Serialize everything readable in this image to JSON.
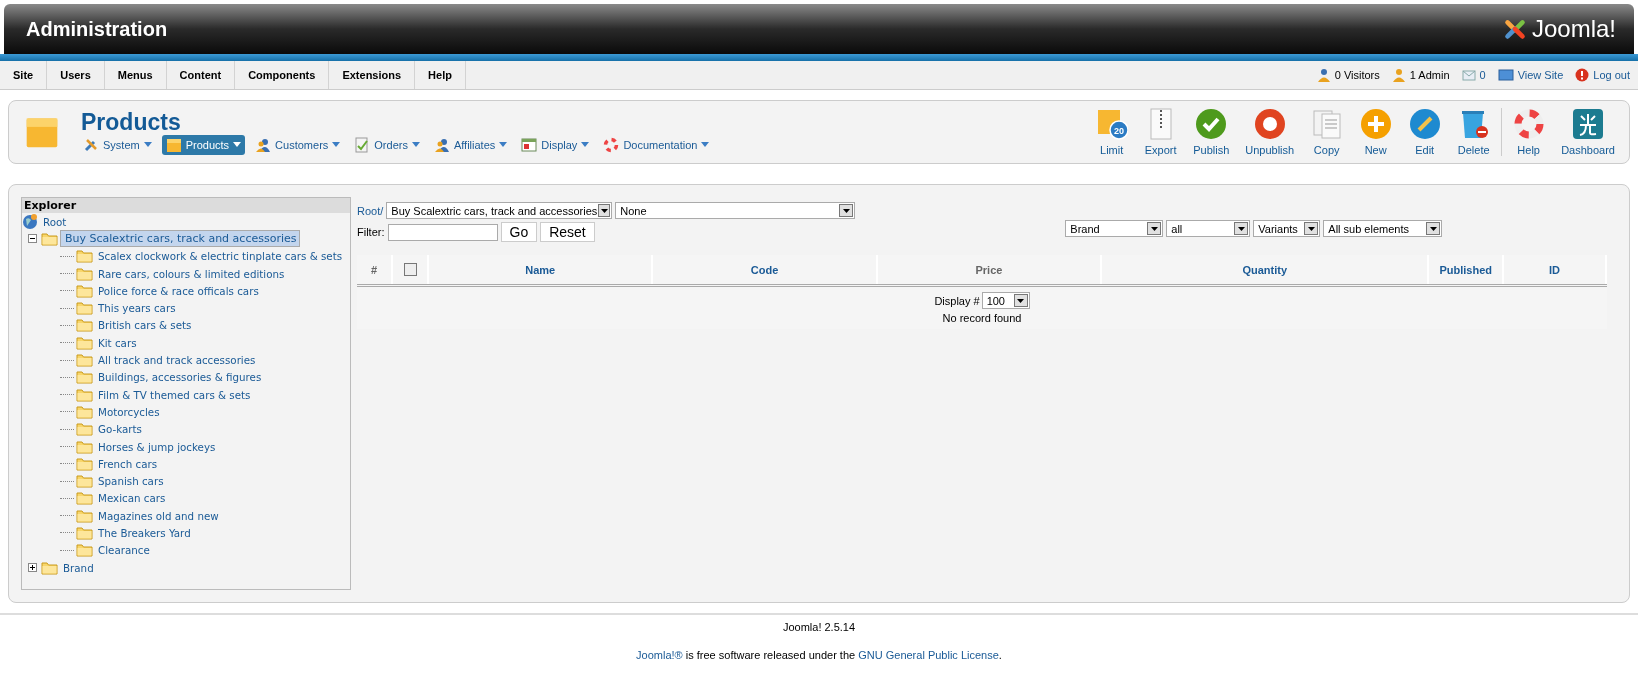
{
  "header": {
    "title": "Administration",
    "logo": "Joomla!"
  },
  "menu": {
    "items": [
      {
        "label": "Site"
      },
      {
        "label": "Users"
      },
      {
        "label": "Menus"
      },
      {
        "label": "Content"
      },
      {
        "label": "Components"
      },
      {
        "label": "Extensions"
      },
      {
        "label": "Help"
      }
    ],
    "status": [
      {
        "kind": "visitors",
        "label": "0 Visitors"
      },
      {
        "kind": "admin",
        "label": "1 Admin"
      },
      {
        "kind": "messages",
        "label": "0"
      },
      {
        "kind": "viewsite",
        "label": "View Site"
      },
      {
        "kind": "logout",
        "label": "Log out"
      }
    ]
  },
  "toolbar": {
    "title": "Products",
    "submenu": [
      {
        "kind": "system",
        "label": "System",
        "selected": false
      },
      {
        "kind": "products",
        "label": "Products",
        "selected": true
      },
      {
        "kind": "customers",
        "label": "Customers",
        "selected": false
      },
      {
        "kind": "orders",
        "label": "Orders",
        "selected": false
      },
      {
        "kind": "affiliates",
        "label": "Affiliates",
        "selected": false
      },
      {
        "kind": "display",
        "label": "Display",
        "selected": false
      },
      {
        "kind": "documentation",
        "label": "Documentation",
        "selected": false
      }
    ],
    "groups": [
      {
        "buttons": [
          {
            "kind": "limit",
            "label": "Limit",
            "badge": "20"
          },
          {
            "kind": "export",
            "label": "Export"
          },
          {
            "kind": "publish",
            "label": "Publish"
          },
          {
            "kind": "unpublish",
            "label": "Unpublish"
          },
          {
            "kind": "copy",
            "label": "Copy"
          },
          {
            "kind": "new",
            "label": "New"
          },
          {
            "kind": "edit",
            "label": "Edit"
          },
          {
            "kind": "delete",
            "label": "Delete"
          }
        ]
      },
      {
        "buttons": [
          {
            "kind": "help",
            "label": "Help"
          },
          {
            "kind": "dashboard",
            "label": "Dashboard"
          }
        ]
      }
    ]
  },
  "explorer": {
    "title": "Explorer",
    "tree": [
      {
        "kind": "root",
        "label": "Root",
        "selected": false,
        "children": [
          {
            "kind": "folder",
            "label": "Buy Scalextric cars, track and accessories",
            "selected": true,
            "expanded": true,
            "children": [
              {
                "kind": "folder",
                "label": "Scalex clockwork & electric tinplate cars & sets",
                "selected": false
              },
              {
                "kind": "folder",
                "label": "Rare cars, colours & limited editions",
                "selected": false
              },
              {
                "kind": "folder",
                "label": "Police force & race officals cars",
                "selected": false
              },
              {
                "kind": "folder",
                "label": "This years cars",
                "selected": false
              },
              {
                "kind": "folder",
                "label": "British cars & sets",
                "selected": false
              },
              {
                "kind": "folder",
                "label": "Kit cars",
                "selected": false
              },
              {
                "kind": "folder",
                "label": "All track and track accessories",
                "selected": false
              },
              {
                "kind": "folder",
                "label": "Buildings, accessories & figures",
                "selected": false
              },
              {
                "kind": "folder",
                "label": "Film & TV themed cars & sets",
                "selected": false
              },
              {
                "kind": "folder",
                "label": "Motorcycles",
                "selected": false
              },
              {
                "kind": "folder",
                "label": "Go-karts",
                "selected": false
              },
              {
                "kind": "folder",
                "label": "Horses & jump jockeys",
                "selected": false
              },
              {
                "kind": "folder",
                "label": "French cars",
                "selected": false
              },
              {
                "kind": "folder",
                "label": "Spanish cars",
                "selected": false
              },
              {
                "kind": "folder",
                "label": "Mexican cars",
                "selected": false
              },
              {
                "kind": "folder",
                "label": "Magazines old and new",
                "selected": false
              },
              {
                "kind": "folder",
                "label": "The Breakers Yard",
                "selected": false
              },
              {
                "kind": "folder",
                "label": "Clearance",
                "selected": false
              }
            ]
          },
          {
            "kind": "folder",
            "label": "Brand",
            "selected": false,
            "expanded": false
          }
        ]
      }
    ]
  },
  "filters": {
    "breadcrumb": "Root/",
    "category": "Buy Scalextric cars, track and accessories",
    "subcategory": "None",
    "filter_label": "Filter:",
    "go": "Go",
    "reset": "Reset",
    "selects": [
      "Brand",
      "all",
      "Variants",
      "All sub elements"
    ]
  },
  "table": {
    "columns": [
      {
        "kind": "text",
        "label": "#",
        "sortable": false
      },
      {
        "kind": "checkbox",
        "checked": false
      },
      {
        "kind": "text",
        "label": "Name",
        "sortable": true
      },
      {
        "kind": "text",
        "label": "Code",
        "sortable": true
      },
      {
        "kind": "text",
        "label": "Price",
        "sortable": false
      },
      {
        "kind": "text",
        "label": "Quantity",
        "sortable": true
      },
      {
        "kind": "text",
        "label": "Published",
        "sortable": true
      },
      {
        "kind": "text",
        "label": "ID",
        "sortable": true
      }
    ],
    "display_label": "Display #",
    "display_value": "100",
    "empty": "No record found"
  },
  "footer": {
    "version": "Joomla! 2.5.14",
    "license": {
      "link": "Joomla!®",
      "text": " is free software released under the ",
      "license_link": "GNU General Public License",
      "end": "."
    }
  }
}
